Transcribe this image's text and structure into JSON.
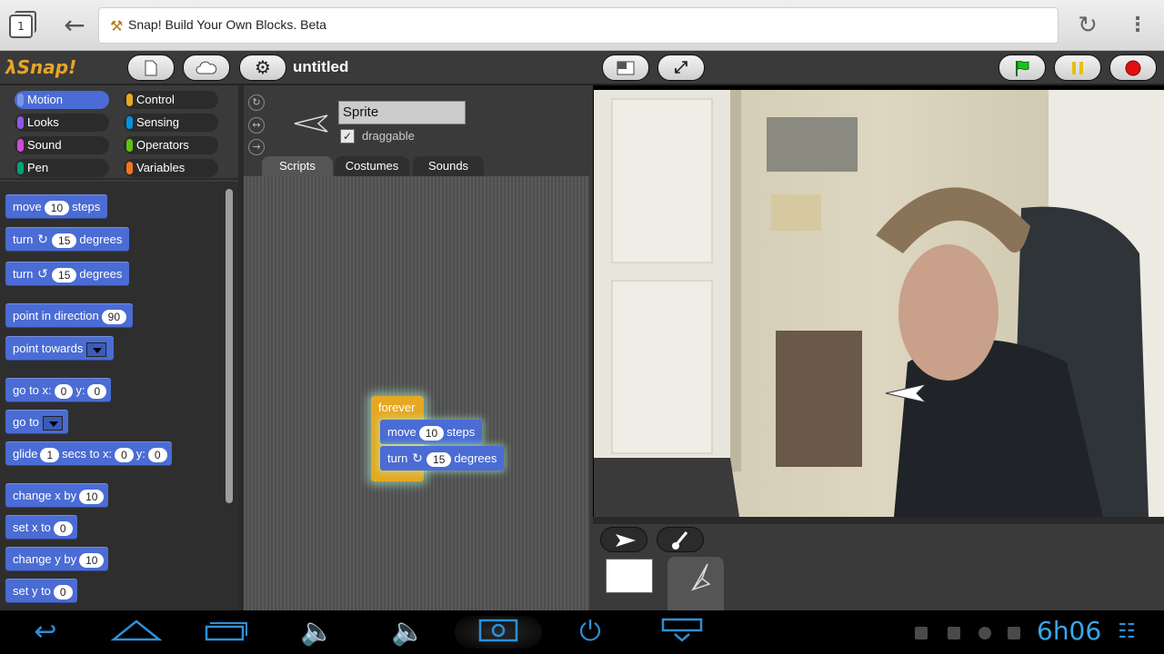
{
  "browser": {
    "tab_count": "1",
    "page_title": "Snap! Build Your Own Blocks. Beta"
  },
  "snap": {
    "logo": "λSnap!",
    "project_title": "untitled"
  },
  "categories": [
    {
      "label": "Motion",
      "color": "#4a6cd4"
    },
    {
      "label": "Control",
      "color": "#e6a822"
    },
    {
      "label": "Looks",
      "color": "#8f56e3"
    },
    {
      "label": "Sensing",
      "color": "#0494dc"
    },
    {
      "label": "Sound",
      "color": "#cf4ad9"
    },
    {
      "label": "Operators",
      "color": "#62c213"
    },
    {
      "label": "Pen",
      "color": "#00a178"
    },
    {
      "label": "Variables",
      "color": "#f3761d"
    }
  ],
  "palette": {
    "move": {
      "a": "move",
      "v": "10",
      "b": "steps"
    },
    "turn_cw": {
      "a": "turn",
      "v": "15",
      "b": "degrees"
    },
    "turn_ccw": {
      "a": "turn",
      "v": "15",
      "b": "degrees"
    },
    "point_dir": {
      "a": "point in direction",
      "v": "90"
    },
    "point_towards": {
      "a": "point towards"
    },
    "goto_xy": {
      "a": "go to x:",
      "x": "0",
      "b": "y:",
      "y": "0"
    },
    "goto": {
      "a": "go to"
    },
    "glide": {
      "a": "glide",
      "s": "1",
      "b": "secs to x:",
      "x": "0",
      "c": "y:",
      "y": "0"
    },
    "change_x": {
      "a": "change x by",
      "v": "10"
    },
    "set_x": {
      "a": "set x to",
      "v": "0"
    },
    "change_y": {
      "a": "change y by",
      "v": "10"
    },
    "set_y": {
      "a": "set y to",
      "v": "0"
    }
  },
  "sprite": {
    "name": "Sprite",
    "draggable_label": "draggable"
  },
  "tabs": [
    "Scripts",
    "Costumes",
    "Sounds"
  ],
  "script": {
    "forever": "forever",
    "move": {
      "a": "move",
      "v": "10",
      "b": "steps"
    },
    "turn": {
      "a": "turn",
      "v": "15",
      "b": "degrees"
    }
  },
  "status": {
    "clock": "6h06"
  }
}
